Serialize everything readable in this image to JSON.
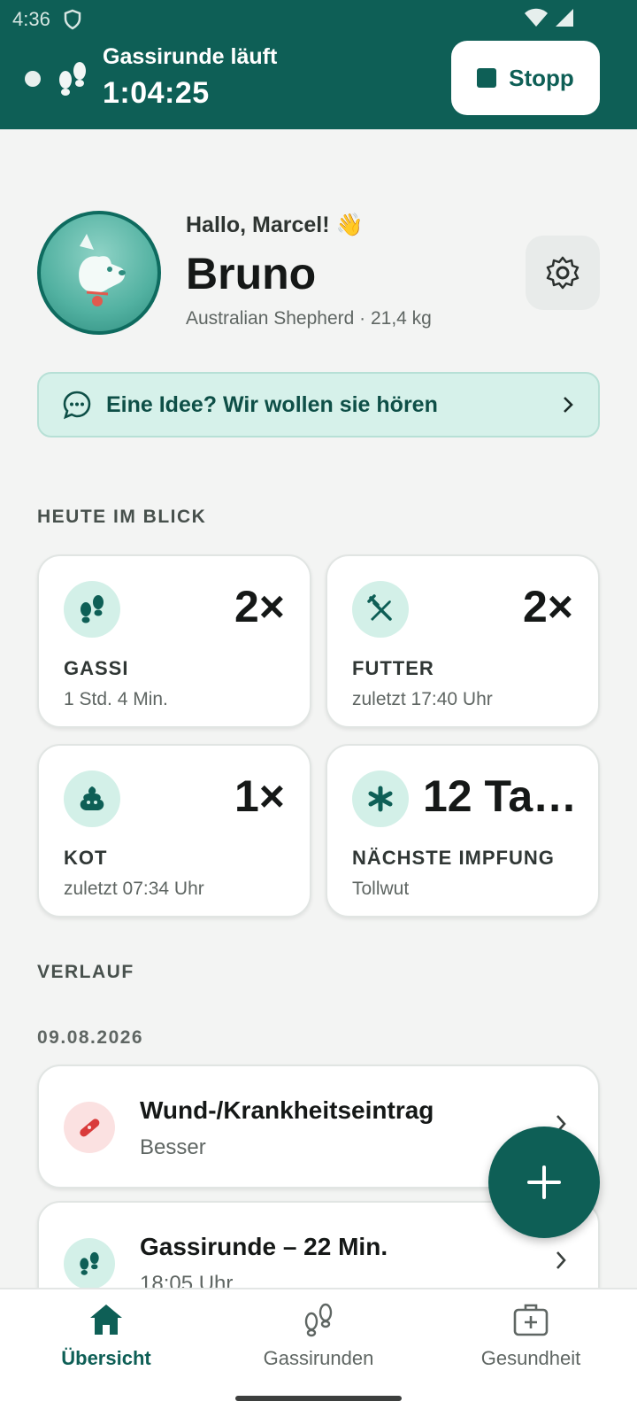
{
  "status_bar": {
    "time": "4:36"
  },
  "walk_banner": {
    "title": "Gassirunde läuft",
    "elapsed": "1:04:25",
    "stop_label": "Stopp"
  },
  "profile": {
    "greeting": "Hallo, Marcel! 👋",
    "dog_name": "Bruno",
    "dog_meta": "Australian Shepherd · 21,4 kg"
  },
  "feedback_banner": {
    "label": "Eine Idee? Wir wollen sie hören"
  },
  "today": {
    "heading": "HEUTE IM BLICK",
    "cards": [
      {
        "icon": "paws-icon",
        "value": "2×",
        "label": "GASSI",
        "sub": "1 Std. 4 Min."
      },
      {
        "icon": "cutlery-icon",
        "value": "2×",
        "label": "FUTTER",
        "sub": "zuletzt 17:40 Uhr"
      },
      {
        "icon": "poop-icon",
        "value": "1×",
        "label": "KOT",
        "sub": "zuletzt 07:34 Uhr"
      },
      {
        "icon": "asterisk-icon",
        "value": "12 Ta…",
        "label": "NÄCHSTE IMPFUNG",
        "sub": "Tollwut"
      }
    ]
  },
  "history": {
    "heading": "VERLAUF",
    "date": "09.08.2026",
    "entries": [
      {
        "icon": "bandage-icon",
        "title": "Wund-/Krankheitseintrag",
        "sub": "Besser"
      },
      {
        "icon": "paws-icon",
        "title": "Gassirunde – 22 Min.",
        "sub": "18:05 Uhr"
      }
    ]
  },
  "nav": {
    "items": [
      {
        "icon": "home-icon",
        "label": "Übersicht",
        "active": true
      },
      {
        "icon": "walk-icon",
        "label": "Gassirunden",
        "active": false
      },
      {
        "icon": "medical-case-icon",
        "label": "Gesundheit",
        "active": false
      }
    ]
  },
  "colors": {
    "primary": "#0e5f56",
    "mint": "#d3f0e8",
    "background": "#f3f4f3"
  }
}
